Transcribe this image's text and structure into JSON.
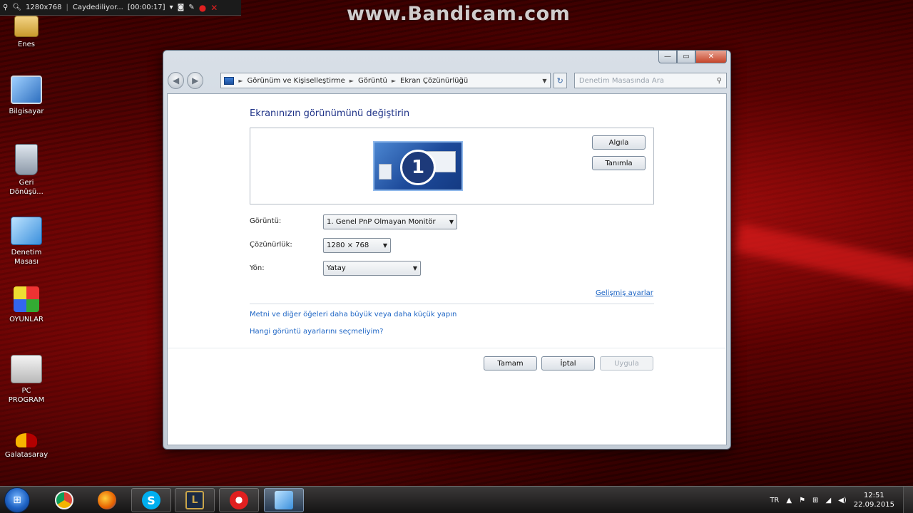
{
  "bandicam": {
    "resolution": "1280x768",
    "status": "Caydediliyor...",
    "timer": "[00:00:17]",
    "watermark": "www.Bandicam.com"
  },
  "desktop_icons": [
    {
      "label": "Enes",
      "icon": "user-folder-icon"
    },
    {
      "label": "Bilgisayar",
      "icon": "computer-icon"
    },
    {
      "label": "Geri Dönüşü...",
      "icon": "recycle-bin-icon"
    },
    {
      "label": "Denetim Masası",
      "icon": "control-panel-icon"
    },
    {
      "label": "OYUNLAR",
      "icon": "games-folder-icon"
    },
    {
      "label": "PC PROGRAM",
      "icon": "program-box-icon"
    },
    {
      "label": "Galatasaray",
      "icon": "galatasaray-logo-icon"
    }
  ],
  "window": {
    "caption": {
      "minimize": "—",
      "maximize": "▭",
      "close": "✕"
    },
    "breadcrumb": [
      "Görünüm ve Kişiselleştirme",
      "Görüntü",
      "Ekran Çözünürlüğü"
    ],
    "search_placeholder": "Denetim Masasında Ara",
    "title": "Ekranınızın görünümünü değiştirin",
    "monitor_number": "1",
    "detect_button": "Algıla",
    "identify_button": "Tanımla",
    "display_label": "Görüntü:",
    "display_value": "1. Genel PnP Olmayan Monitör",
    "resolution_label": "Çözünürlük:",
    "resolution_value": "1280 × 768",
    "orientation_label": "Yön:",
    "orientation_value": "Yatay",
    "advanced_link": "Gelişmiş ayarlar",
    "text_size_link": "Metni ve diğer öğeleri daha büyük veya daha küçük yapın",
    "which_settings_link": "Hangi görüntü ayarlarını seçmeliyim?",
    "ok_button": "Tamam",
    "cancel_button": "İptal",
    "apply_button": "Uygula"
  },
  "taskbar": {
    "language": "TR",
    "time": "12:51",
    "date": "22.09.2015"
  },
  "colors": {
    "title_blue": "#1e3287",
    "link_blue": "#1c64c4"
  }
}
